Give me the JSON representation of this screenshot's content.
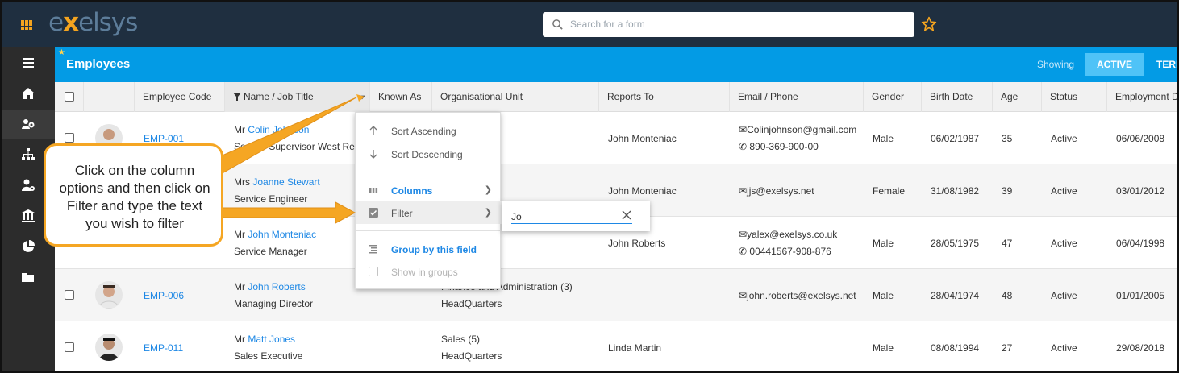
{
  "app": {
    "logo_left": "e",
    "logo_x": "x",
    "logo_right": "elsys"
  },
  "search": {
    "placeholder": "Search for a form"
  },
  "page": {
    "title": "Employees",
    "showing_label": "Showing",
    "active_label": "ACTIVE",
    "terminated_label": "TERM"
  },
  "columns": [
    "Employee Code",
    "Name / Job Title",
    "Known As",
    "Organisational Unit",
    "Reports To",
    "Email / Phone",
    "Gender",
    "Birth Date",
    "Age",
    "Status",
    "Employment Da"
  ],
  "rows": [
    {
      "code": "EMP-001",
      "title": "Mr",
      "name": "Colin Johnson",
      "job": "Service Supervisor West Region",
      "org": "",
      "org2": "",
      "reports_to": "John Monteniac",
      "email": "Colinjohnson@gmail.com",
      "phone": "890-369-900-00",
      "gender": "Male",
      "birth": "06/02/1987",
      "age": "35",
      "status": "Active",
      "employment": "06/06/2008"
    },
    {
      "code": "",
      "title": "Mrs",
      "name": "Joanne Stewart",
      "job": "Service Engineer",
      "org": "",
      "org2": "",
      "reports_to": "John Monteniac",
      "email": "jjs@exelsys.net",
      "phone": "",
      "gender": "Female",
      "birth": "31/08/1982",
      "age": "39",
      "status": "Active",
      "employment": "03/01/2012"
    },
    {
      "code": "",
      "title": "Mr",
      "name": "John Monteniac",
      "job": "Service Manager",
      "org": "",
      "org2": "",
      "reports_to": "John Roberts",
      "email": "yalex@exelsys.co.uk",
      "phone": "00441567-908-876",
      "gender": "Male",
      "birth": "28/05/1975",
      "age": "47",
      "status": "Active",
      "employment": "06/04/1998"
    },
    {
      "code": "EMP-006",
      "title": "Mr",
      "name": "John Roberts",
      "job": "Managing Director",
      "org": "Finance and Administration (3)",
      "org2": "HeadQuarters",
      "reports_to": "",
      "email": "john.roberts@exelsys.net",
      "phone": "",
      "gender": "Male",
      "birth": "28/04/1974",
      "age": "48",
      "status": "Active",
      "employment": "01/01/2005"
    },
    {
      "code": "EMP-011",
      "title": "Mr",
      "name": "Matt Jones",
      "job": "Sales Executive",
      "org": "Sales (5)",
      "org2": "HeadQuarters",
      "reports_to": "Linda Martin",
      "email": "",
      "phone": "",
      "gender": "Male",
      "birth": "08/08/1994",
      "age": "27",
      "status": "Active",
      "employment": "29/08/2018"
    }
  ],
  "column_menu": {
    "sort_asc": "Sort Ascending",
    "sort_desc": "Sort Descending",
    "columns": "Columns",
    "filter": "Filter",
    "group": "Group by this field",
    "show_groups": "Show in groups"
  },
  "filter": {
    "value": "Jo"
  },
  "callout": {
    "text": "Click on the column options and then click on Filter and type the text you wish to filter"
  },
  "colors": {
    "topbar": "#1f2f40",
    "band": "#039be5",
    "accent": "#f5a623",
    "link": "#1e88e5"
  }
}
